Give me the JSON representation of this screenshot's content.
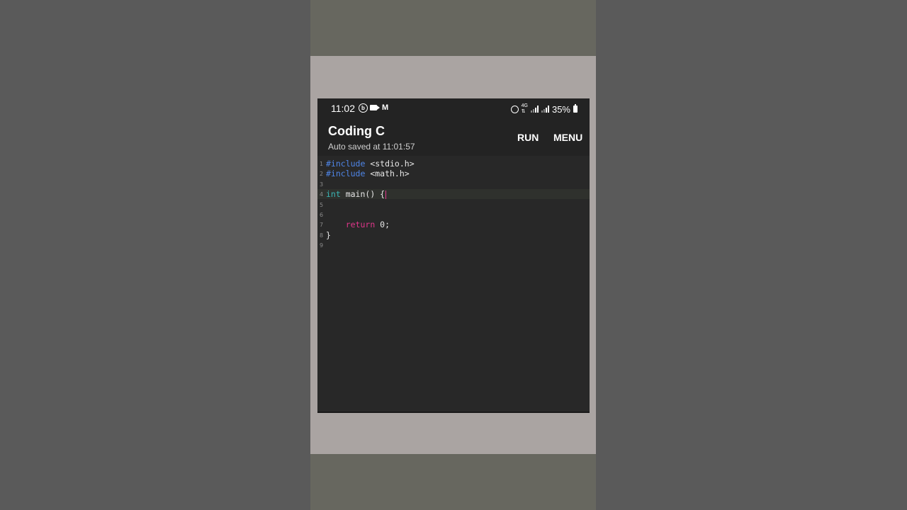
{
  "status_bar": {
    "time": "11:02",
    "battery": "35%",
    "left_icons": [
      "b-circle-icon",
      "video-icon",
      "gmail-icon"
    ],
    "right_icons": [
      "alarm-icon",
      "4g-icon",
      "signal-icon",
      "signal-icon",
      "battery-icon"
    ]
  },
  "app_bar": {
    "title": "Coding C",
    "subtitle": "Auto saved at 11:01:57",
    "run_label": "RUN",
    "menu_label": "MENU"
  },
  "editor": {
    "lines": [
      {
        "num": "1",
        "parts": [
          {
            "t": "#include",
            "c": "inc"
          },
          {
            "t": " <stdio.h>",
            "c": "plain"
          }
        ]
      },
      {
        "num": "2",
        "parts": [
          {
            "t": "#include",
            "c": "inc"
          },
          {
            "t": " <math.h>",
            "c": "plain"
          }
        ]
      },
      {
        "num": "3",
        "parts": []
      },
      {
        "num": "4",
        "parts": [
          {
            "t": "int",
            "c": "type"
          },
          {
            "t": " main() {",
            "c": "plain"
          }
        ]
      },
      {
        "num": "5",
        "parts": []
      },
      {
        "num": "6",
        "parts": []
      },
      {
        "num": "7",
        "parts": [
          {
            "t": "    ",
            "c": "plain"
          },
          {
            "t": "return",
            "c": "ret"
          },
          {
            "t": " 0;",
            "c": "plain"
          }
        ]
      },
      {
        "num": "8",
        "parts": [
          {
            "t": "}",
            "c": "plain"
          }
        ]
      },
      {
        "num": "9",
        "parts": []
      }
    ],
    "active_line": 4
  },
  "colors": {
    "include": "#4f86e8",
    "type": "#39b5b5",
    "return": "#e0368a",
    "background": "#282828"
  }
}
